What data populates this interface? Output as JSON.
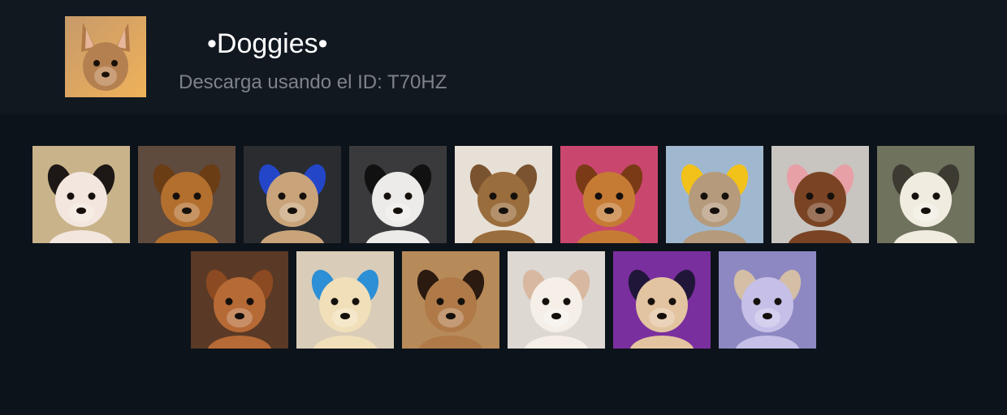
{
  "pack": {
    "title": "•Doggies•",
    "subtitle": "Descarga usando el ID: T70HZ",
    "cover_icon": "chihuahua-sticker"
  },
  "stickers": {
    "row1": [
      {
        "name": "chihuahua-cowboy-hat",
        "bg": "#c9b38a",
        "fur": "#f3e6de",
        "accent": "#1d1715"
      },
      {
        "name": "brown-dog-side-eye",
        "bg": "#5f4a3e",
        "fur": "#b36f2e",
        "accent": "#6b3d15"
      },
      {
        "name": "pug-on-couch",
        "bg": "#2a2c30",
        "fur": "#c9a47a",
        "accent": "#2346c9"
      },
      {
        "name": "white-dog-sunglasses",
        "bg": "#3a3a3c",
        "fur": "#ecebea",
        "accent": "#111111"
      },
      {
        "name": "puppy-thinking",
        "bg": "#e7e0d6",
        "fur": "#9a6d3c",
        "accent": "#7a5330"
      },
      {
        "name": "chihuahua-screaming",
        "bg": "#c9476e",
        "fur": "#c57b34",
        "accent": "#7a3a15"
      },
      {
        "name": "dog-cap-tongue",
        "bg": "#9fb8cf",
        "fur": "#b59a7c",
        "accent": "#f2c21a"
      },
      {
        "name": "dachshund-tongue",
        "bg": "#c8c5c0",
        "fur": "#7a4424",
        "accent": "#e6a0a6"
      },
      {
        "name": "white-spitz-car",
        "bg": "#6f725d",
        "fur": "#f1ece0",
        "accent": "#3d3a32"
      }
    ],
    "row2": [
      {
        "name": "golden-puppy-paw",
        "bg": "#5a3a26",
        "fur": "#b66a35",
        "accent": "#8c4a22"
      },
      {
        "name": "crying-puppy",
        "bg": "#d9cdb9",
        "fur": "#f0dfb9",
        "accent": "#2d8fd6"
      },
      {
        "name": "chihuahua-portrait",
        "bg": "#b78a5a",
        "fur": "#b07a48",
        "accent": "#2a1a10"
      },
      {
        "name": "chihuahua-praying",
        "bg": "#ded8d3",
        "fur": "#f5efe8",
        "accent": "#d8b8a0"
      },
      {
        "name": "chihuahua-mullet-concert",
        "bg": "#7a2f9e",
        "fur": "#e3c4a0",
        "accent": "#20163a"
      },
      {
        "name": "chihuahua-blanket",
        "bg": "#8d88c2",
        "fur": "#c6c0e8",
        "accent": "#d4bfa6"
      }
    ]
  }
}
